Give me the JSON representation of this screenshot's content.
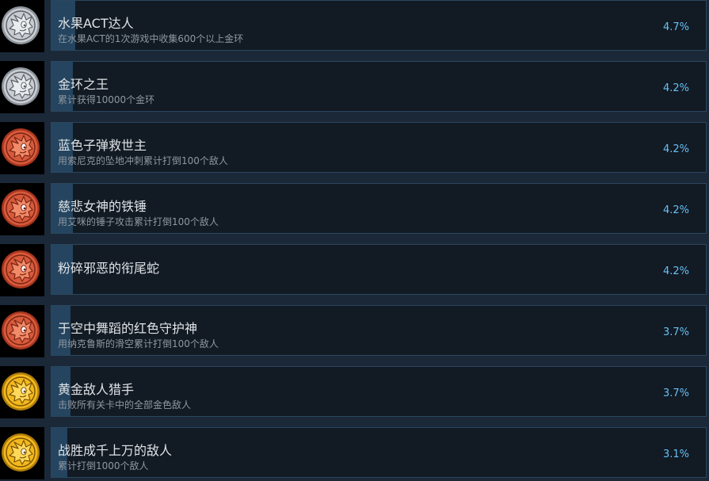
{
  "colors": {
    "page_background": "#1b2838",
    "card_background": "#121a24",
    "card_border": "#2a475e",
    "progress_fill": "#24445f",
    "title_text": "#dfe3e6",
    "description_text": "#8f98a0",
    "percent_text": "#66c0f4",
    "medal_silver": "#c9cdd2",
    "medal_bronze": "#d85a3c",
    "medal_gold": "#f2b81e"
  },
  "achievements": [
    {
      "icon": "silver-sonic-medal-icon",
      "tier": "silver",
      "title": "水果ACT达人",
      "description": "在水果ACT的1次游戏中收集600个以上金环",
      "percent": "4.7%",
      "progress": 0.047
    },
    {
      "icon": "silver-sonic-medal-icon",
      "tier": "silver",
      "title": "金环之王",
      "description": "累计获得10000个金环",
      "percent": "4.2%",
      "progress": 0.042
    },
    {
      "icon": "bronze-sonic-medal-icon",
      "tier": "bronze",
      "title": "蓝色子弹救世主",
      "description": "用索尼克的坠地冲刺累计打倒100个敌人",
      "percent": "4.2%",
      "progress": 0.042
    },
    {
      "icon": "bronze-sonic-medal-icon",
      "tier": "bronze",
      "title": "慈悲女神的铁锤",
      "description": "用艾咪的锤子攻击累计打倒100个敌人",
      "percent": "4.2%",
      "progress": 0.042
    },
    {
      "icon": "bronze-sonic-medal-icon",
      "tier": "bronze",
      "title": "粉碎邪恶的衔尾蛇",
      "description": "",
      "percent": "4.2%",
      "progress": 0.042
    },
    {
      "icon": "bronze-sonic-medal-icon",
      "tier": "bronze",
      "title": "于空中舞蹈的红色守护神",
      "description": "用纳克鲁斯的滑空累计打倒100个敌人",
      "percent": "3.7%",
      "progress": 0.037
    },
    {
      "icon": "gold-sonic-medal-icon",
      "tier": "gold",
      "title": "黄金敌人猎手",
      "description": "击败所有关卡中的全部金色敌人",
      "percent": "3.7%",
      "progress": 0.037
    },
    {
      "icon": "gold-sonic-medal-icon",
      "tier": "gold",
      "title": "战胜成千上万的敌人",
      "description": "累计打倒1000个敌人",
      "percent": "3.1%",
      "progress": 0.031
    }
  ]
}
